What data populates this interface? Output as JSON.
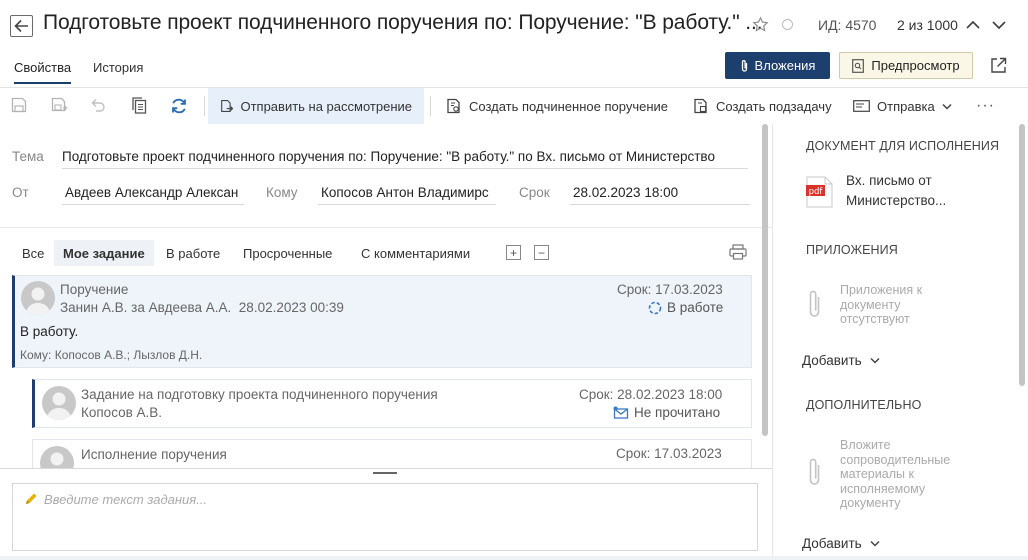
{
  "header": {
    "title": "Подготовьте проект подчиненного поручения по: Поручение: \"В работу.\" ...",
    "doc_id": "ИД: 4570",
    "pager": "2 из 1000"
  },
  "tabs": [
    {
      "label": "Свойства"
    },
    {
      "label": "История"
    }
  ],
  "actions": {
    "attachments": "Вложения",
    "preview": "Предпросмотр"
  },
  "toolbar": {
    "send_review": "Отправить на рассмотрение",
    "create_sub_order": "Создать подчиненное поручение",
    "create_subtask": "Создать подзадачу",
    "send": "Отправка",
    "more": "···"
  },
  "fields": {
    "subject_label": "Тема",
    "subject_value": "Подготовьте проект подчиненного поручения по: Поручение: \"В работу.\" по Вх. письмо от Министерство",
    "from_label": "От",
    "from_value": "Авдеев Александр Алексан",
    "to_label": "Кому",
    "to_value": "Копосов Антон Владимирс",
    "deadline_label": "Срок",
    "deadline_value": "28.02.2023 18:00"
  },
  "filters": [
    {
      "label": "Все"
    },
    {
      "label": "Мое задание"
    },
    {
      "label": "В работе"
    },
    {
      "label": "Просроченные"
    },
    {
      "label": "С комментариями"
    }
  ],
  "expand_symbol": "+",
  "collapse_symbol": "−",
  "cards": [
    {
      "title": "Поручение",
      "author": "Занин А.В. за Авдеева А.А.",
      "date": "28.02.2023 00:39",
      "deadline": "Срок: 17.03.2023",
      "status": "В работе",
      "body": "В работу.",
      "recipients": "Кому: Копосов А.В.; Лызлов Д.Н."
    },
    {
      "title": "Задание на подготовку проекта подчиненного поручения",
      "author": "Копосов А.В.",
      "deadline": "Срок: 28.02.2023 18:00",
      "status": "Не прочитано"
    },
    {
      "title": "Исполнение поручения",
      "deadline": "Срок: 17.03.2023"
    }
  ],
  "comment": {
    "placeholder": "Введите текст задания..."
  },
  "right_panel": {
    "doc_heading": "ДОКУМЕНТ ДЛЯ ИСПОЛНЕНИЯ",
    "doc_icon_label": "pdf",
    "doc_name_line1": "Вх. письмо от",
    "doc_name_line2": "Министерство...",
    "attachments_heading": "ПРИЛОЖЕНИЯ",
    "attachments_empty": [
      "Приложения к",
      "документу",
      "отсутствуют"
    ],
    "add_label": "Добавить",
    "extra_heading": "ДОПОЛНИТЕЛЬНО",
    "extra_hint": [
      "Вложите",
      "сопроводительные",
      "материалы к",
      "исполняемому",
      "документу"
    ],
    "add_label_2": "Добавить"
  },
  "colors": {
    "primary": "#1c3f6e",
    "preview_bg": "#fbf7e6",
    "active_bg": "#e7f0fa",
    "card_bg": "#eff4fa",
    "refresh_icon": "#2b6cb0",
    "mail_icon": "#3a78c2",
    "pdf_red": "#d8322b",
    "pencil": "#e9b300"
  },
  "icons": [
    "back-arrow-icon",
    "star-icon",
    "status-circle-icon",
    "chevron-up-icon",
    "chevron-down-icon",
    "paperclip-icon",
    "preview-icon",
    "popout-icon",
    "save-icon",
    "save-as-icon",
    "undo-icon",
    "copy-icon",
    "refresh-icon",
    "send-review-icon",
    "create-sub-order-icon",
    "create-subtask-icon",
    "send-icon",
    "print-icon",
    "pdf-icon",
    "pencil-icon",
    "mail-icon",
    "spinner-icon"
  ]
}
